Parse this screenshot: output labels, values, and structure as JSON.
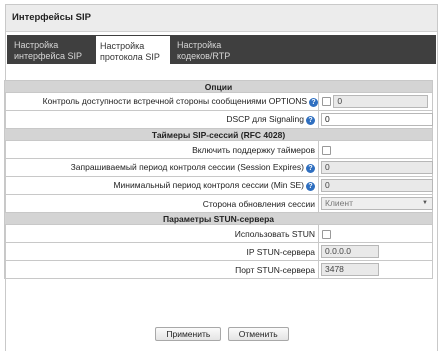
{
  "window": {
    "title": "Интерфейсы SIP"
  },
  "tabs": [
    {
      "line1": "Настройка",
      "line2": "интерфейса SIP"
    },
    {
      "line1": "Настройка",
      "line2": "протокола SIP"
    },
    {
      "line1": "Настройка",
      "line2": "кодеков/RTP"
    }
  ],
  "sections": {
    "options": "Опции",
    "timers": "Таймеры SIP-сессий (RFC 4028)",
    "stun": "Параметры STUN-сервера"
  },
  "fields": {
    "options_check": {
      "label": "Контроль доступности встречной стороны сообщениями OPTIONS",
      "value": "0"
    },
    "dscp": {
      "label": "DSCP для Signaling",
      "value": "0"
    },
    "timers_enable": {
      "label": "Включить поддержку таймеров"
    },
    "session_expires": {
      "label": "Запрашиваемый период контроля сессии (Session Expires)",
      "value": "0"
    },
    "min_se": {
      "label": "Минимальный период контроля сессии (Min SE)",
      "value": "0"
    },
    "refresher": {
      "label": "Сторона обновления сессии",
      "value": "Клиент"
    },
    "use_stun": {
      "label": "Использовать STUN"
    },
    "stun_ip": {
      "label": "IP STUN-сервера",
      "value": "0.0.0.0"
    },
    "stun_port": {
      "label": "Порт STUN-сервера",
      "value": "3478"
    }
  },
  "buttons": {
    "apply": "Применить",
    "cancel": "Отменить"
  },
  "colors": {
    "tabbar": "#3f3f3f",
    "section_header": "#d4d4d4",
    "help_icon": "#2f6fc0"
  }
}
